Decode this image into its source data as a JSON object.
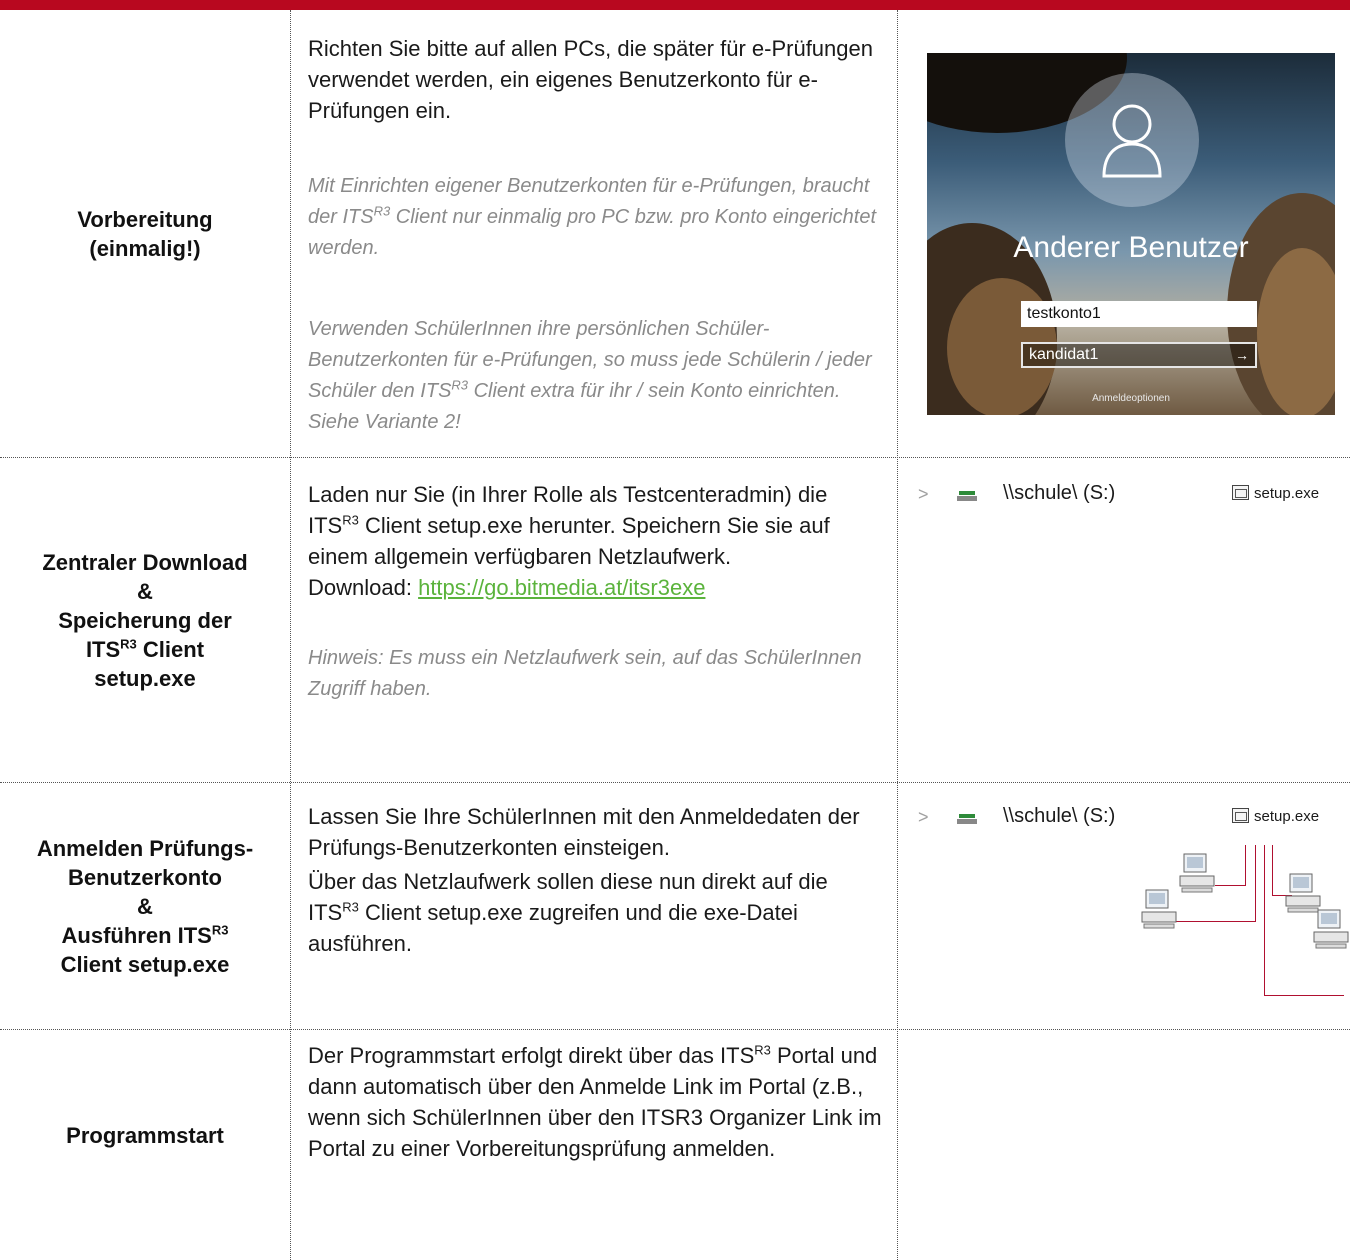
{
  "colors": {
    "accent_bar": "#b8081f",
    "link": "#5bb33c",
    "note": "#8a8a8a"
  },
  "rows": [
    {
      "label_line1": "Vorbereitung",
      "label_line2": "(einmalig!)",
      "main_text": "Richten Sie bitte auf allen PCs, die später für e-Prüfungen verwendet werden, ein eigenes Benutzerkonto für e-Prüfungen ein.",
      "note1_a": "Mit Einrichten eigener Benutzerkonten für e-Prüfungen, braucht der ITS",
      "note1_sup": "R3",
      "note1_b": " Client nur einmalig pro PC bzw. pro Konto eingerichtet werden.",
      "note2_a": "Verwenden SchülerInnen ihre persönlichen Schüler-Benutzerkonten für e-Prüfungen, so muss jede Schülerin / jeder Schüler den ITS",
      "note2_sup": "R3",
      "note2_b": " Client extra für ihr / sein Konto einrichten. Siehe Variante 2!",
      "image": {
        "user_name": "Anderer Benutzer",
        "username_value": "testkonto1",
        "password_value": "kandidat1",
        "submit_arrow": "→",
        "options_label": "Anmeldeoptionen"
      }
    },
    {
      "label_line1": "Zentraler Download",
      "label_line2": "&",
      "label_line3": "Speicherung der",
      "label_its": "ITS",
      "label_sup": "R3",
      "label_client": " Client",
      "label_line5": "setup.exe",
      "main_a": "Laden nur Sie (in Ihrer Rolle als Testcenteradmin) die ITS",
      "main_sup": "R3",
      "main_b": " Client setup.exe herunter. Speichern Sie sie auf einem allgemein verfügbaren Netzlaufwerk.",
      "download_label": "Download: ",
      "download_link": "https://go.bitmedia.at/itsr3exe",
      "note": "Hinweis: Es muss ein Netzlaufwerk sein, auf das SchülerInnen Zugriff haben.",
      "drive_label": "\\\\schule\\ (S:)",
      "file_label": "setup.exe",
      "chevron": ">"
    },
    {
      "label_line1": "Anmelden Prüfungs-",
      "label_line2": "Benutzerkonto",
      "label_line3": "&",
      "label_line4a": "Ausführen ITS",
      "label_sup": "R3",
      "label_line5": "Client setup.exe",
      "para1": "Lassen Sie Ihre SchülerInnen mit den Anmeldedaten der Prüfungs-Benutzerkonten einsteigen.",
      "para2_a": "Über das Netzlaufwerk sollen diese nun direkt auf die ITS",
      "para2_sup": "R3",
      "para2_b": " Client setup.exe zugreifen und die exe-Datei ausführen.",
      "drive_label": "\\\\schule\\ (S:)",
      "file_label": "setup.exe",
      "chevron": ">"
    },
    {
      "label_line1": "Programmstart",
      "main_a": "Der Programmstart erfolgt direkt über das ITS",
      "main_sup": "R3",
      "main_b": " Portal und dann automatisch über den Anmelde Link im Portal (z.B., wenn sich SchülerInnen über den ITSR3 Organizer Link im Portal zu einer Vorbereitungsprüfung anmelden."
    }
  ]
}
